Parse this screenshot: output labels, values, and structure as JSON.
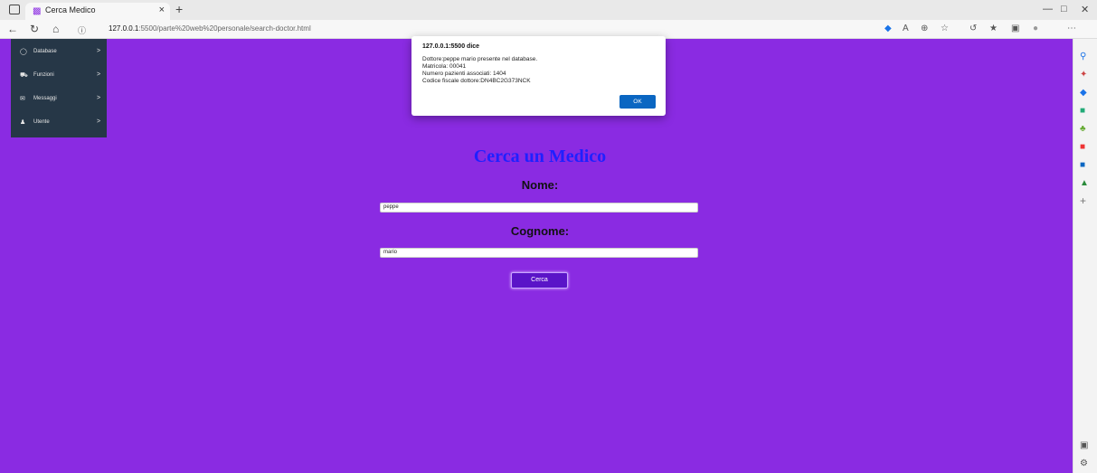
{
  "browser": {
    "tab_title": "Cerca Medico",
    "tab_close": "×",
    "new_tab": "+",
    "url_host": "127.0.0.1",
    "url_path": ":5500/parte%20web%20personale/search-doctor.html",
    "icons": [
      "back-icon",
      "refresh-icon",
      "home-icon",
      "info-icon",
      "favorites-icon",
      "read-aloud-icon",
      "zoom-icon",
      "collections-icon",
      "more-icon"
    ]
  },
  "sidebar": {
    "items": [
      {
        "label": "Database",
        "chevron": ">"
      },
      {
        "label": "Funzioni",
        "chevron": ">"
      },
      {
        "label": "Messaggi",
        "chevron": ">"
      },
      {
        "label": "Utente",
        "chevron": ">"
      }
    ]
  },
  "form": {
    "heading": "Cerca un Medico",
    "nome_label": "Nome:",
    "nome_value": "peppe",
    "cognome_label": "Cognome:",
    "cognome_value": "mario",
    "search_label": "Cerca"
  },
  "dialog": {
    "title": "127.0.0.1:5500 dice",
    "lines": [
      "Dottore:peppe mario presente nel database.",
      "Matricola: 00041",
      "Numero pazienti associati: 1404",
      "Codice fiscale dottore:DN4BC2G373NCK"
    ],
    "ok_label": "OK"
  },
  "colors": {
    "page_background": "#8a2be2",
    "sidebar": "#263747",
    "heading": "#2020ff",
    "ok_button": "#0a66c2"
  }
}
